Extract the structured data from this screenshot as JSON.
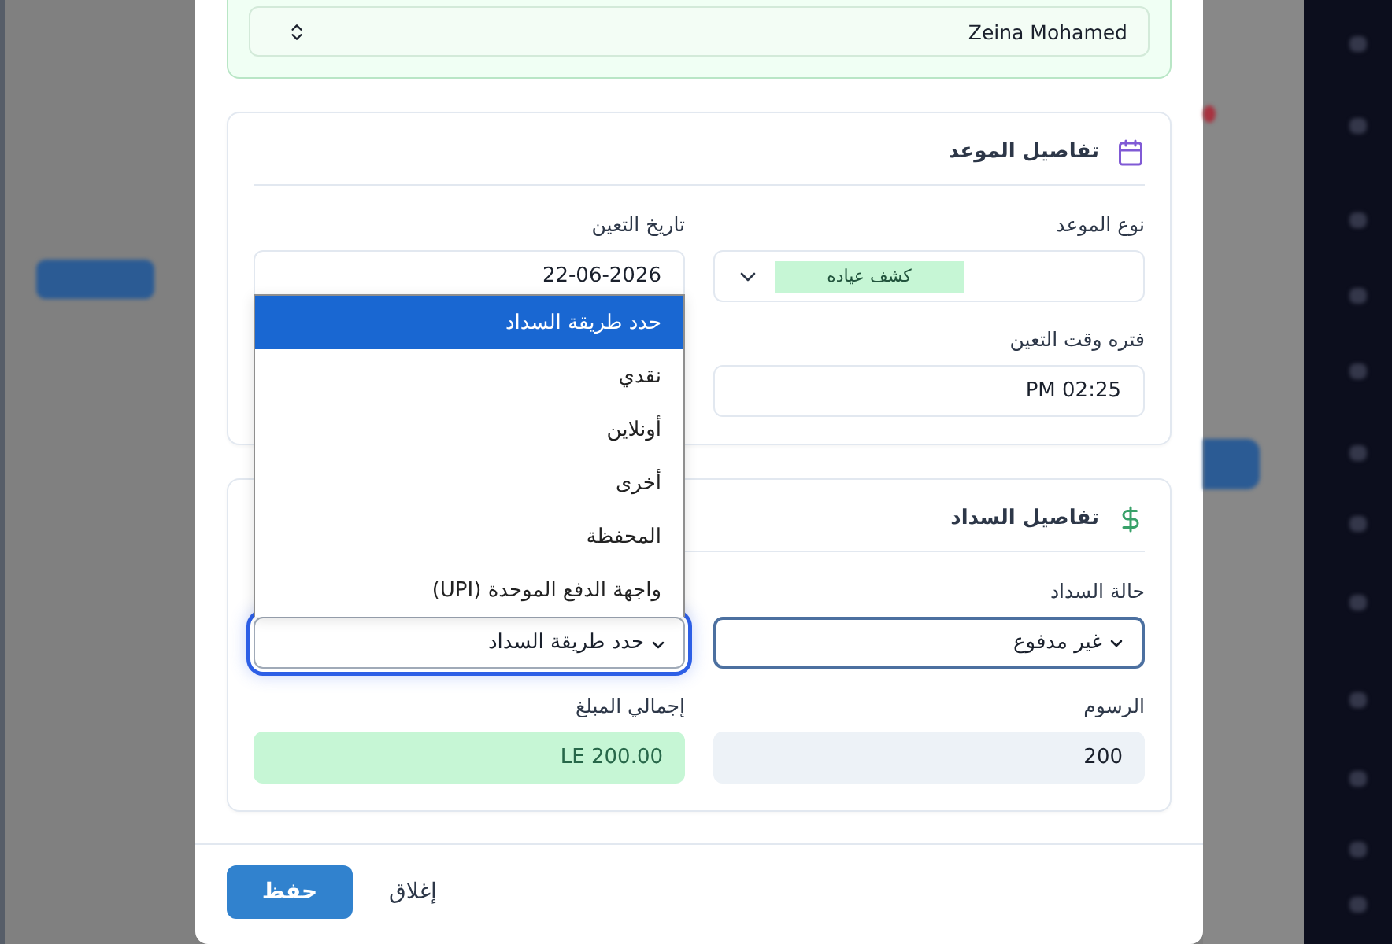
{
  "patient": {
    "name": "Zeina Mohamed"
  },
  "appointment_details": {
    "title": "تفاصيل الموعد",
    "fields": [
      {
        "kind": "badge_select",
        "label": "نوع الموعد",
        "value": "كشف عياده"
      },
      {
        "kind": "date",
        "label": "تاريخ التعين",
        "value": "22-06-2026"
      },
      {
        "kind": "time",
        "label": "فتره وقت التعين",
        "value": "PM 02:25"
      }
    ]
  },
  "payment_details": {
    "title": "تفاصيل السداد",
    "fields": [
      {
        "kind": "select",
        "label": "حالة السداد",
        "value": "غير مدفوع",
        "focused": false,
        "expanded": false
      },
      {
        "kind": "select",
        "value": "حدد طريقة السداد",
        "focused": true,
        "expanded": true,
        "options": [
          {
            "label": "حدد طريقة السداد",
            "selected": true
          },
          {
            "label": "نقدي",
            "selected": false
          },
          {
            "label": "أونلاين",
            "selected": false
          },
          {
            "label": "أخرى",
            "selected": false
          },
          {
            "label": "المحفظة",
            "selected": false
          },
          {
            "label": "واجهة الدفع الموحدة (UPI)",
            "selected": false
          }
        ]
      },
      {
        "kind": "readonly",
        "label": "الرسوم",
        "value": "200"
      },
      {
        "kind": "total",
        "label": "إجمالي المبلغ",
        "value": "LE 200.00"
      }
    ]
  },
  "footer": {
    "buttons": [
      {
        "kind": "ghost",
        "label": "إغلاق"
      },
      {
        "kind": "primary",
        "label": "حفظ"
      }
    ]
  }
}
